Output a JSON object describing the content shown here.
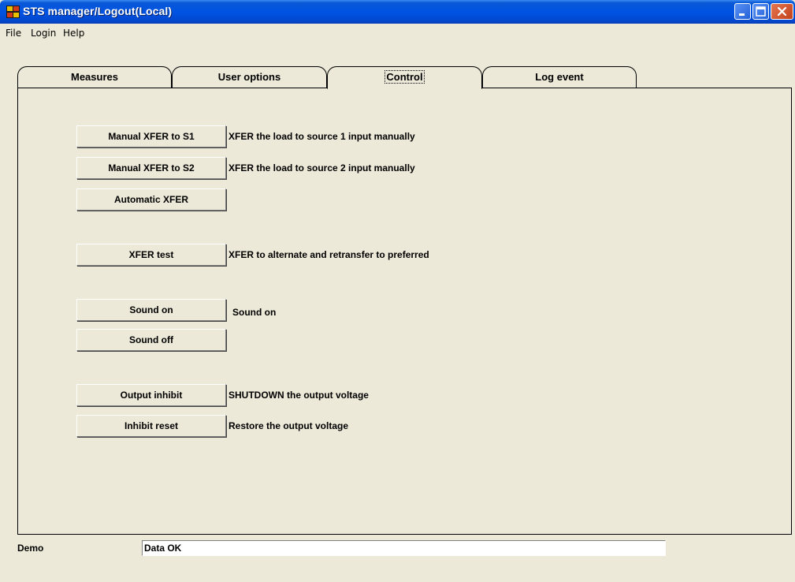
{
  "window": {
    "title": "STS manager/Logout(Local)"
  },
  "menu": [
    "File",
    "Login",
    "Help"
  ],
  "tabs": [
    {
      "label": "Measures",
      "active": false
    },
    {
      "label": "User options",
      "active": false
    },
    {
      "label": "Control",
      "active": true
    },
    {
      "label": "Log event",
      "active": false
    }
  ],
  "controls": {
    "manual_xfer_s1": {
      "label": "Manual XFER to S1",
      "desc": "XFER the load to source 1 input manually"
    },
    "manual_xfer_s2": {
      "label": "Manual XFER to S2",
      "desc": "XFER the load to source 2 input manually"
    },
    "automatic_xfer": {
      "label": "Automatic XFER"
    },
    "xfer_test": {
      "label": "XFER test",
      "desc": "XFER to alternate and retransfer to preferred"
    },
    "sound_on": {
      "label": "Sound on",
      "desc": "Sound on"
    },
    "sound_off": {
      "label": "Sound off"
    },
    "output_inhibit": {
      "label": "Output inhibit",
      "desc": "SHUTDOWN the output voltage"
    },
    "inhibit_reset": {
      "label": "Inhibit reset",
      "desc": "Restore the output voltage"
    }
  },
  "status": {
    "mode": "Demo",
    "message": "Data OK"
  },
  "icons": {
    "app": "app-grid-icon",
    "minimize": "minimize-icon",
    "maximize": "maximize-icon",
    "close": "close-icon"
  },
  "colors": {
    "titlebar": "#0054e3",
    "face": "#ece9d8",
    "close_button": "#c2411c"
  }
}
